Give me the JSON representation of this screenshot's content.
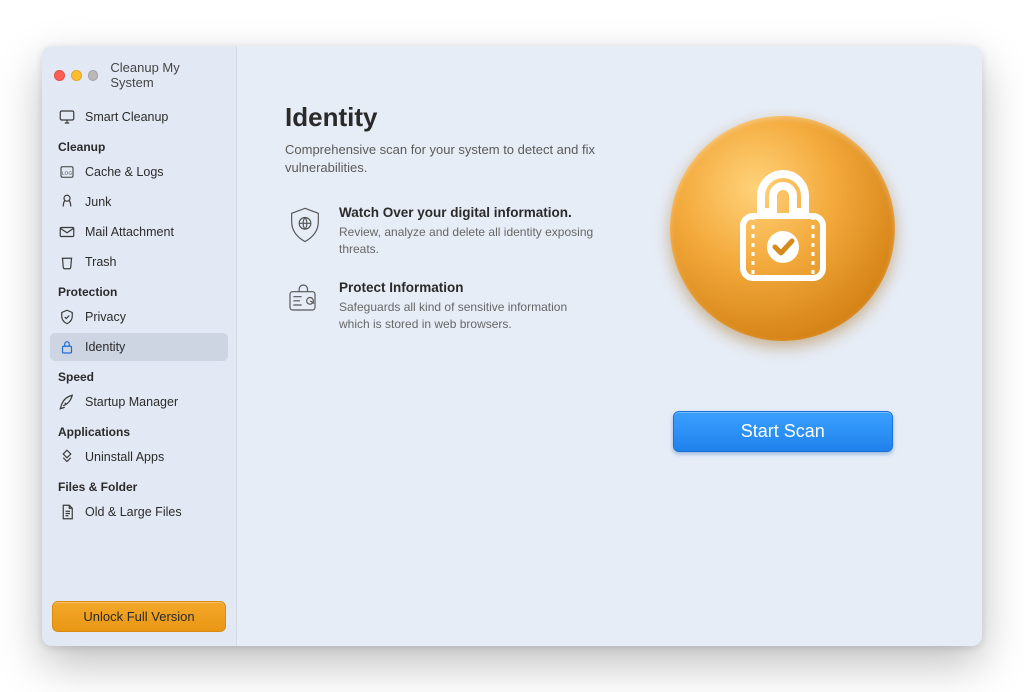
{
  "app": {
    "title": "Cleanup My System"
  },
  "sidebar": {
    "smart_cleanup": "Smart Cleanup",
    "sections": {
      "cleanup": {
        "title": "Cleanup",
        "items": [
          {
            "label": "Cache & Logs",
            "active": false
          },
          {
            "label": "Junk",
            "active": false
          },
          {
            "label": "Mail Attachment",
            "active": false
          },
          {
            "label": "Trash",
            "active": false
          }
        ]
      },
      "protection": {
        "title": "Protection",
        "items": [
          {
            "label": "Privacy",
            "active": false
          },
          {
            "label": "Identity",
            "active": true
          }
        ]
      },
      "speed": {
        "title": "Speed",
        "items": [
          {
            "label": "Startup Manager",
            "active": false
          }
        ]
      },
      "applications": {
        "title": "Applications",
        "items": [
          {
            "label": "Uninstall Apps",
            "active": false
          }
        ]
      },
      "files": {
        "title": "Files & Folder",
        "items": [
          {
            "label": "Old & Large Files",
            "active": false
          }
        ]
      }
    },
    "unlock_label": "Unlock Full Version"
  },
  "main": {
    "title": "Identity",
    "subtitle": "Comprehensive scan for your system to detect and fix vulnerabilities.",
    "features": [
      {
        "heading": "Watch Over your digital information.",
        "body": "Review, analyze and delete all identity exposing threats."
      },
      {
        "heading": "Protect Information",
        "body": "Safeguards all kind of sensitive information which is stored in web browsers."
      }
    ],
    "scan_label": "Start Scan"
  },
  "colors": {
    "accent_orange": "#e99816",
    "accent_blue": "#1f82ec",
    "hero_gradient": [
      "#ffd27a",
      "#f3a93b",
      "#d27f12",
      "#b96b08"
    ]
  }
}
